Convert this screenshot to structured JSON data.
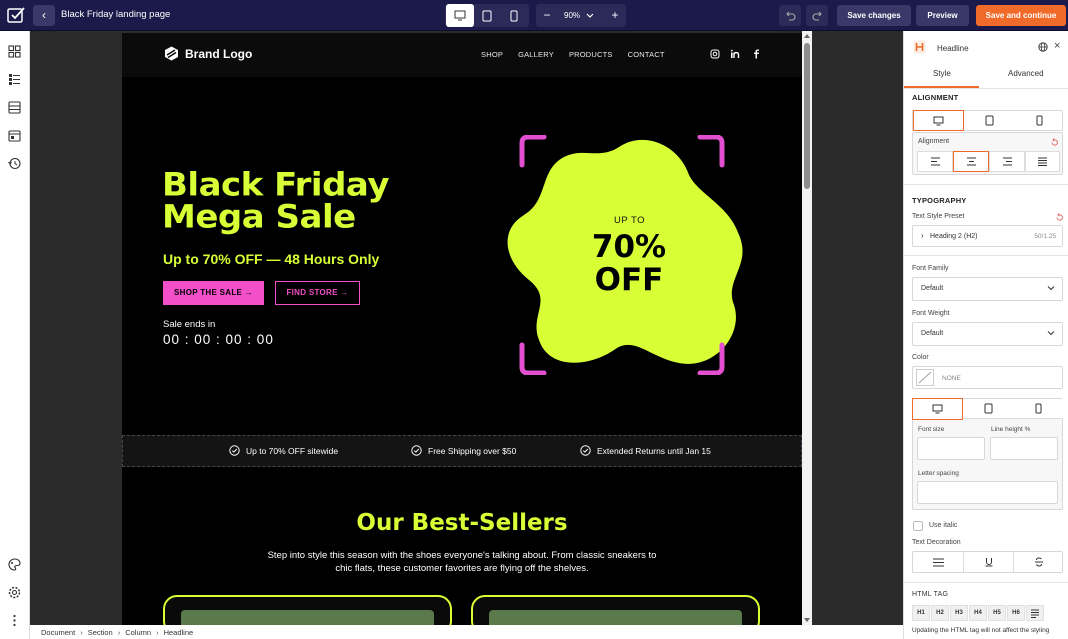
{
  "topbar": {
    "title": "Black Friday landing page",
    "zoom": "90%",
    "save_label": "Save changes",
    "preview_label": "Preview",
    "continue_label": "Save and continue"
  },
  "site": {
    "brand": "Brand Logo",
    "nav": [
      "SHOP",
      "GALLERY",
      "PRODUCTS",
      "CONTACT"
    ],
    "hero_title_line1": "Black Friday",
    "hero_title_line2": "Mega Sale",
    "hero_subtitle": "Up to 70% OFF — 48 Hours Only",
    "shop_button": "SHOP THE SALE →",
    "find_button": "FIND STORE →",
    "sale_label": "Sale ends in",
    "countdown": "00 : 00 : 00 : 00",
    "blob_small": "UP TO",
    "blob_big": "70% OFF",
    "usps": [
      "Up to 70% OFF sitewide",
      "Free Shipping over $50",
      "Extended Returns until Jan 15"
    ],
    "best_title": "Our Best-Sellers",
    "best_desc": "Step into style this season with the shoes everyone's talking about. From classic sneakers to chic flats, these customer favorites are flying off the shelves.",
    "colors": {
      "accent": "#d8ff36",
      "pink": "#f24fc8",
      "bg": "#000000"
    }
  },
  "breadcrumb": [
    "Document",
    "Section",
    "Column",
    "Headline"
  ],
  "panel": {
    "header": "Headline",
    "tabs": [
      "Style",
      "Advanced"
    ],
    "alignment_heading": "ALIGNMENT",
    "alignment_label": "Alignment",
    "typography_heading": "TYPOGRAPHY",
    "text_style_label": "Text Style Preset",
    "text_style_value": "Heading 2 (H2)",
    "text_style_meta": "50/1.25",
    "font_family_label": "Font Family",
    "font_family_value": "Default",
    "font_weight_label": "Font Weight",
    "font_weight_value": "Default",
    "color_label": "Color",
    "color_value": "NONE",
    "font_size_label": "Font size",
    "line_height_label": "Line height %",
    "letter_spacing_label": "Letter spacing",
    "italic_label": "Use italic",
    "decoration_label": "Text Decoration",
    "html_tag_label": "HTML TAG",
    "html_tags": [
      "H1",
      "H2",
      "H3",
      "H4",
      "H5",
      "H6"
    ],
    "note": "Updating the HTML tag will not affect the styling",
    "accent": "#f06a2a"
  }
}
